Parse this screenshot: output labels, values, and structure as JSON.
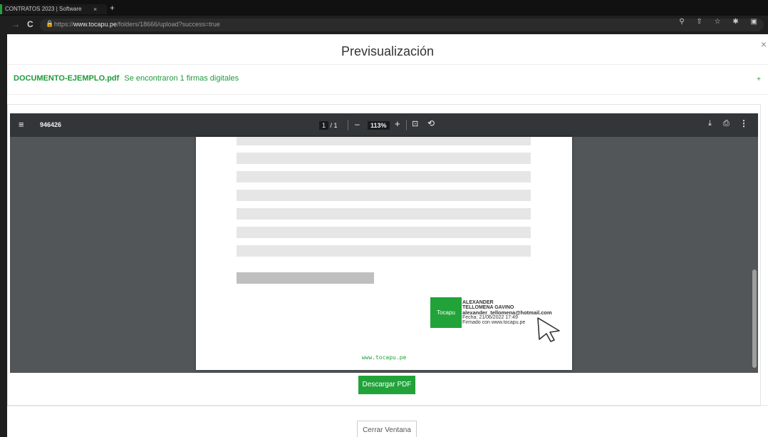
{
  "browser": {
    "tab_title": "CONTRATOS 2023 | Software",
    "tab_close": "×",
    "new_tab": "+",
    "url_prefix": "https://",
    "url_domain": "www.tocapu.pe",
    "url_path": "/folders/18666/upload?success=true"
  },
  "modal": {
    "title": "Previsualización",
    "close": "×",
    "document_name": "DOCUMENTO-EJEMPLO.pdf",
    "signatures_found": "Se encontraron 1 firmas digitales",
    "expand": "+",
    "download_label": "Descargar PDF",
    "close_label": "Cerrar Ventana"
  },
  "viewer": {
    "doc_title": "946426",
    "page_current": "1",
    "page_total": "/ 1",
    "zoom": "113%",
    "zoom_out": "–",
    "zoom_in": "+"
  },
  "signature": {
    "stamp_label": "Tocapu",
    "name_line1": "ALEXANDER",
    "name_line2": "TELLOMENA GAVINO",
    "email": "alexander_tellomena@hotmail.com",
    "date": "Fecha: 21/06/2022 17:49",
    "signed_with": "Firmado con www.tocapu.pe"
  },
  "page_footer": "www.tocapu.pe",
  "colors": {
    "accent": "#21a33a",
    "viewer_bg": "#525659",
    "toolbar_bg": "#323639"
  },
  "icons": {
    "menu": "hamburger-icon",
    "download": "download-icon",
    "print": "print-icon",
    "more": "more-vert-icon"
  }
}
